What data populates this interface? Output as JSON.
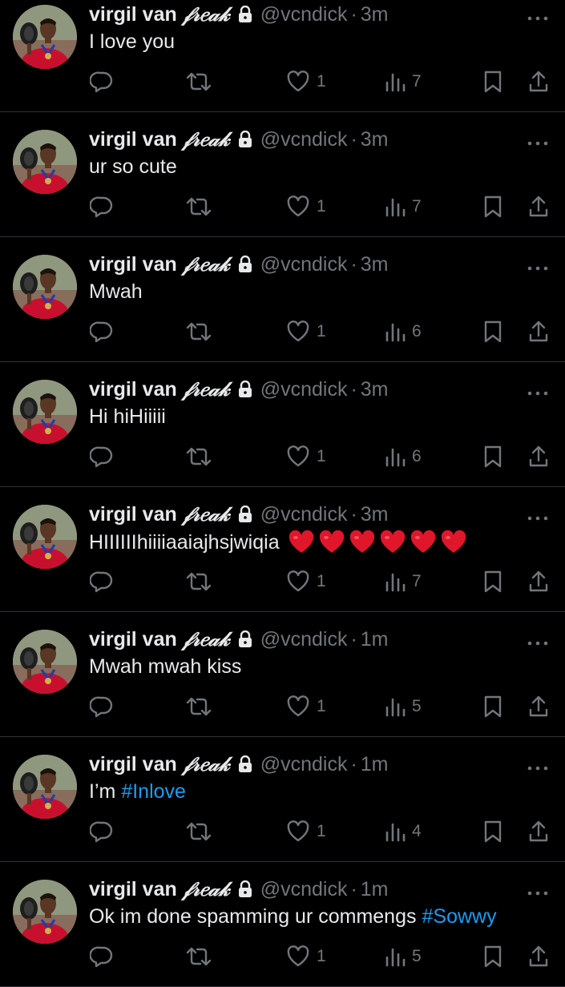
{
  "colors": {
    "background": "#000000",
    "text": "#e7e9ea",
    "secondary": "#71767b",
    "divider": "#2f3336",
    "link": "#1d9bf0",
    "heart_emoji": "#e0162b"
  },
  "icons": {
    "lock": "lock-icon",
    "more": "more-dots-icon",
    "reply": "reply-icon",
    "retweet": "retweet-icon",
    "like": "heart-icon",
    "views": "views-bar-chart-icon",
    "bookmark": "bookmark-icon",
    "share": "share-icon"
  },
  "tweets": [
    {
      "name": "virgil van",
      "name_styled": "𝒻𝓇𝑒𝒶𝓀",
      "handle": "@vcndick",
      "dot": "·",
      "time": "3m",
      "text": "I love you",
      "hashtag": "",
      "hearts": 0,
      "likes": "1",
      "views": "7"
    },
    {
      "name": "virgil van",
      "name_styled": "𝒻𝓇𝑒𝒶𝓀",
      "handle": "@vcndick",
      "dot": "·",
      "time": "3m",
      "text": "ur so cute",
      "hashtag": "",
      "hearts": 0,
      "likes": "1",
      "views": "7"
    },
    {
      "name": "virgil van",
      "name_styled": "𝒻𝓇𝑒𝒶𝓀",
      "handle": "@vcndick",
      "dot": "·",
      "time": "3m",
      "text": "Mwah",
      "hashtag": "",
      "hearts": 0,
      "likes": "1",
      "views": "6"
    },
    {
      "name": "virgil van",
      "name_styled": "𝒻𝓇𝑒𝒶𝓀",
      "handle": "@vcndick",
      "dot": "·",
      "time": "3m",
      "text": "Hi hiHiiiii",
      "hashtag": "",
      "hearts": 0,
      "likes": "1",
      "views": "6"
    },
    {
      "name": "virgil van",
      "name_styled": "𝒻𝓇𝑒𝒶𝓀",
      "handle": "@vcndick",
      "dot": "·",
      "time": "3m",
      "text": "HIIIIIIhiiiiaaiajhsjwiqia",
      "hashtag": "",
      "hearts": 6,
      "likes": "1",
      "views": "7"
    },
    {
      "name": "virgil van",
      "name_styled": "𝒻𝓇𝑒𝒶𝓀",
      "handle": "@vcndick",
      "dot": "·",
      "time": "1m",
      "text": "Mwah mwah kiss",
      "hashtag": "",
      "hearts": 0,
      "likes": "1",
      "views": "5"
    },
    {
      "name": "virgil van",
      "name_styled": "𝒻𝓇𝑒𝒶𝓀",
      "handle": "@vcndick",
      "dot": "·",
      "time": "1m",
      "text": "I’m",
      "hashtag": "#Inlove",
      "hearts": 0,
      "likes": "1",
      "views": "4"
    },
    {
      "name": "virgil van",
      "name_styled": "𝒻𝓇𝑒𝒶𝓀",
      "handle": "@vcndick",
      "dot": "·",
      "time": "1m",
      "text": "Ok im done spamming ur commengs",
      "hashtag": "#Sowwy",
      "hearts": 0,
      "likes": "1",
      "views": "5"
    }
  ]
}
